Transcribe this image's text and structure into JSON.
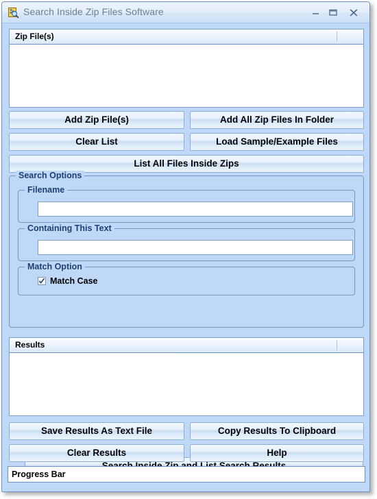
{
  "window": {
    "title": "Search Inside Zip Files Software",
    "icon": "zip-search-app-icon",
    "controls": {
      "minimize": "minimize-icon",
      "maximize": "maximize-icon",
      "close": "close-icon"
    }
  },
  "colors": {
    "window_background": "#bfd8f7",
    "titlebar_text": "#6c7f91",
    "group_caption_text": "#1f3f73",
    "border": "#7596c4",
    "button_face": "#e8f1fb",
    "field_background": "#ffffff"
  },
  "zip_list": {
    "column_header": "Zip File(s)",
    "rows": []
  },
  "file_buttons": {
    "add_zip_files": "Add Zip File(s)",
    "add_all_zip_files_in_folder": "Add All Zip Files In Folder",
    "clear_list": "Clear List",
    "load_sample_example_files": "Load Sample/Example Files",
    "list_all_files_inside_zips": "List All Files Inside Zips"
  },
  "search_options": {
    "caption": "Search Options",
    "filename": {
      "caption": "Filename",
      "value": "",
      "placeholder": ""
    },
    "containing_this_text": {
      "caption": "Containing This Text",
      "value": "",
      "placeholder": ""
    },
    "match_option": {
      "caption": "Match Option",
      "match_case_label": "Match Case",
      "match_case_checked": true
    },
    "search_button": "Search Inside Zip and List Search Results"
  },
  "results_list": {
    "column_header": "Results",
    "rows": []
  },
  "results_buttons": {
    "save_results_as_text_file": "Save Results As Text File",
    "copy_results_to_clipboard": "Copy Results To Clipboard",
    "clear_results": "Clear Results",
    "help": "Help"
  },
  "progress": {
    "label": "Progress Bar",
    "percent": 0
  }
}
